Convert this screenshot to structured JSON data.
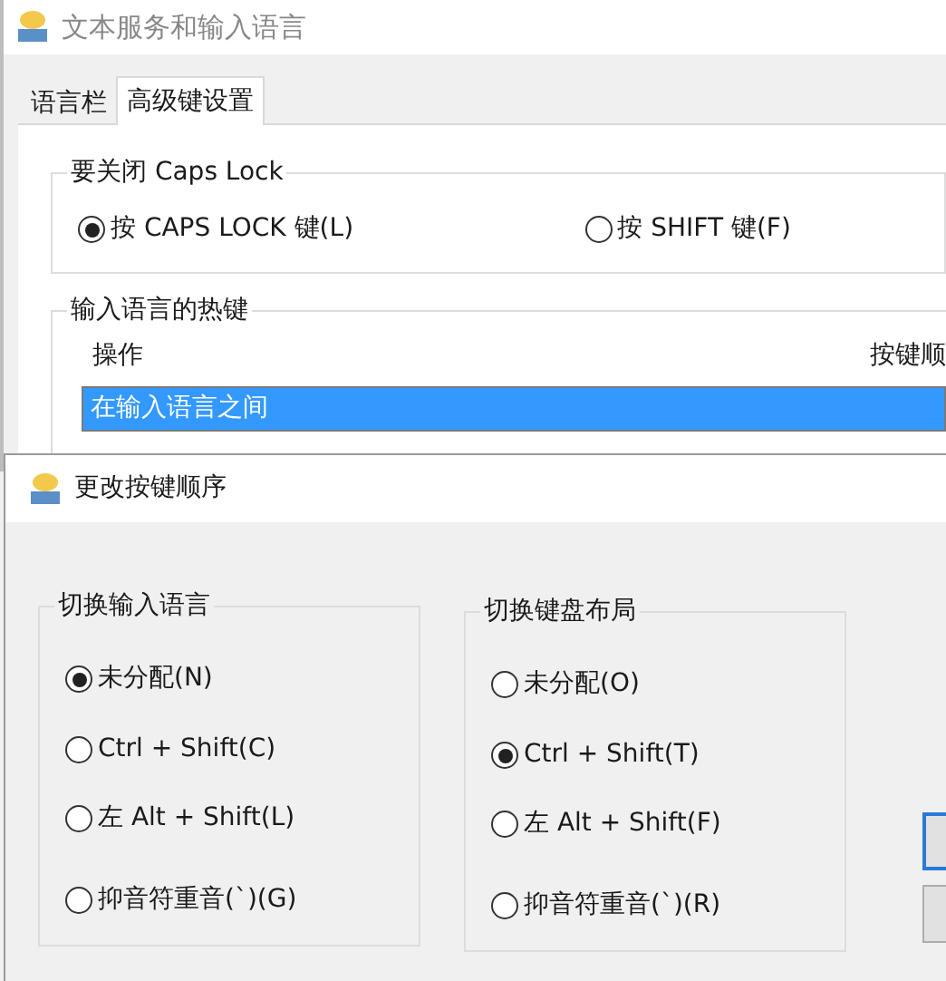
{
  "main_window": {
    "title": "文本服务和输入语言",
    "tabs": [
      {
        "label": "语言栏",
        "selected": false
      },
      {
        "label": "高级键设置",
        "selected": true
      }
    ],
    "caps_lock_group": {
      "title": "要关闭 Caps Lock",
      "options": [
        {
          "label": "按 CAPS LOCK 键(L)",
          "selected": true
        },
        {
          "label": "按 SHIFT 键(F)",
          "selected": false
        }
      ]
    },
    "hotkeys_group": {
      "title": "输入语言的热键",
      "columns": [
        "操作",
        "按键顺"
      ],
      "rows": [
        {
          "action": "在输入语言之间",
          "selected": true
        }
      ]
    }
  },
  "dialog": {
    "title": "更改按键顺序",
    "groups": [
      {
        "title": "切换输入语言",
        "options": [
          {
            "label": "未分配(N)",
            "selected": true
          },
          {
            "label": "Ctrl + Shift(C)",
            "selected": false
          },
          {
            "label": "左 Alt + Shift(L)",
            "selected": false
          },
          {
            "label": "抑音符重音(`)(G)",
            "selected": false
          }
        ]
      },
      {
        "title": "切换键盘布局",
        "options": [
          {
            "label": "未分配(O)",
            "selected": false
          },
          {
            "label": "Ctrl + Shift(T)",
            "selected": true
          },
          {
            "label": "左 Alt + Shift(F)",
            "selected": false
          },
          {
            "label": "抑音符重音(`)(R)",
            "selected": false
          }
        ]
      }
    ],
    "buttons": [
      {
        "focused": true
      },
      {
        "focused": false
      }
    ]
  }
}
